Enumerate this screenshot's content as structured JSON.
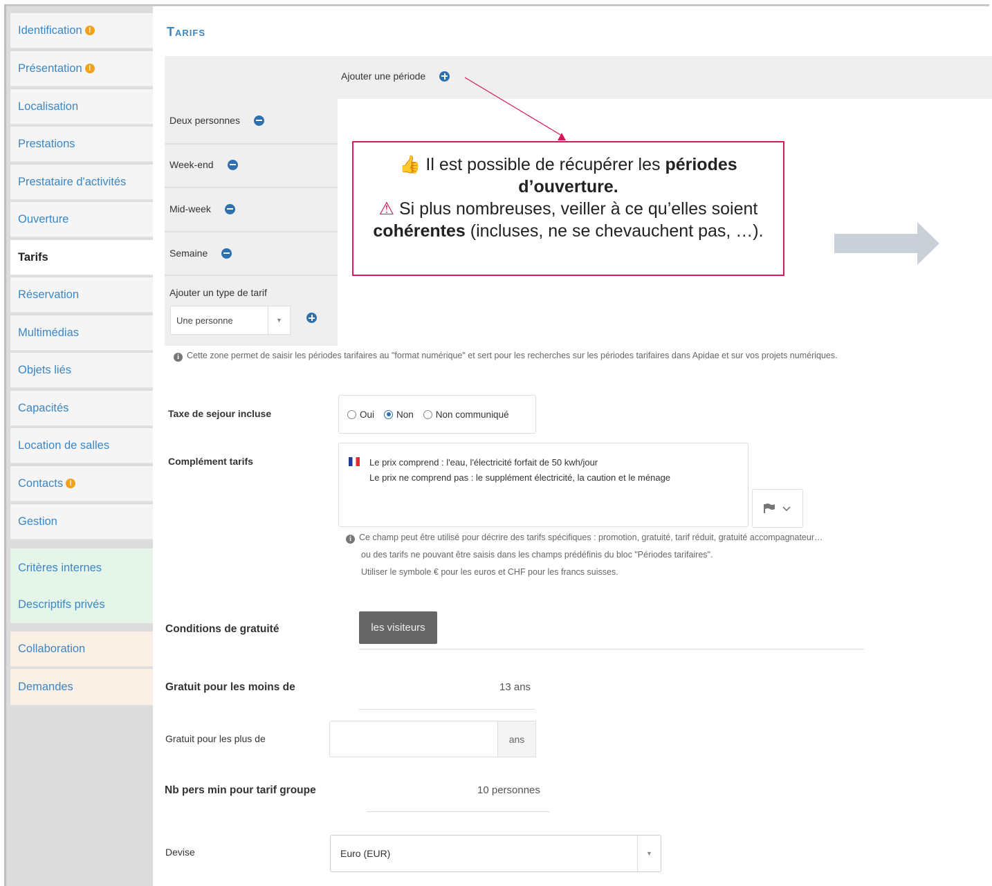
{
  "sidebar": {
    "items": [
      {
        "label": "Identification",
        "warning": true
      },
      {
        "label": "Présentation",
        "warning": true
      },
      {
        "label": "Localisation"
      },
      {
        "label": "Prestations"
      },
      {
        "label": "Prestataire d'activités"
      },
      {
        "label": "Ouverture"
      },
      {
        "label": "Tarifs",
        "active": true
      },
      {
        "label": "Réservation"
      },
      {
        "label": "Multimédias"
      },
      {
        "label": "Objets liés"
      },
      {
        "label": "Capacités"
      },
      {
        "label": "Location de salles"
      },
      {
        "label": "Contacts",
        "warning": true
      },
      {
        "label": "Gestion"
      }
    ],
    "private_items": [
      {
        "label": "Critères internes"
      },
      {
        "label": "Descriptifs privés"
      }
    ],
    "collab_items": [
      {
        "label": "Collaboration"
      },
      {
        "label": "Demandes"
      }
    ],
    "warning_glyph": "!"
  },
  "page": {
    "title": "Tarifs"
  },
  "periodes": {
    "add_label": "Ajouter une période",
    "types": [
      "Deux personnes",
      "Week-end",
      "Mid-week",
      "Semaine"
    ],
    "add_type_label": "Ajouter un type de tarif",
    "add_type_selected": "Une personne",
    "select_arrow": "▼",
    "info": "Cette zone permet de saisir les périodes tarifaires au \"format numérique\" et sert pour les recherches sur les périodes tarifaires dans Apidae et sur vos projets numériques."
  },
  "callout": {
    "thumb_icon": "👍",
    "line1_pre": " Il est possible de récupérer les ",
    "line1_bold": "périodes d’ouverture.",
    "warning_icon": "⚠",
    "line2_pre": " Si plus nombreuses, veiller à ce qu’elles soient ",
    "line2_bold": "cohérentes",
    "line2_post": " (incluses, ne se chevauchent pas, …)."
  },
  "taxe": {
    "label": "Taxe de sejour incluse",
    "options": [
      "Oui",
      "Non",
      "Non communiqué"
    ],
    "selected": "Non"
  },
  "complement": {
    "label": "Complément tarifs",
    "line1": "Le prix comprend : l'eau, l'électricité forfait de 50 kwh/jour",
    "line2": "Le prix ne comprend pas :  le supplément électricité, la caution et le ménage",
    "lang_icon": "flag-icon",
    "info1": "Ce champ peut être utilisé pour décrire des tarifs spécifiques : promotion, gratuité, tarif réduit, gratuité accompagnateur…",
    "info2": "ou des tarifs ne pouvant être saisis dans les champs prédéfinis du bloc \"Périodes tarifaires\".",
    "info3": "Utiliser le symbole € pour les euros et CHF pour les francs suisses."
  },
  "gratuite": {
    "label": "Conditions de gratuité",
    "button": "les visiteurs"
  },
  "moins_de": {
    "label": "Gratuit pour les moins de",
    "value": "13 ans"
  },
  "plus_de": {
    "label": "Gratuit pour les plus de",
    "value": "",
    "addon": "ans"
  },
  "groupe": {
    "label": "Nb pers min pour tarif groupe",
    "value": "10 personnes"
  },
  "devise": {
    "label": "Devise",
    "selected": "Euro (EUR)"
  },
  "colors": {
    "accent": "#3b86c4",
    "callout_border": "#d8185a",
    "icon_blue": "#2e6fb0"
  }
}
